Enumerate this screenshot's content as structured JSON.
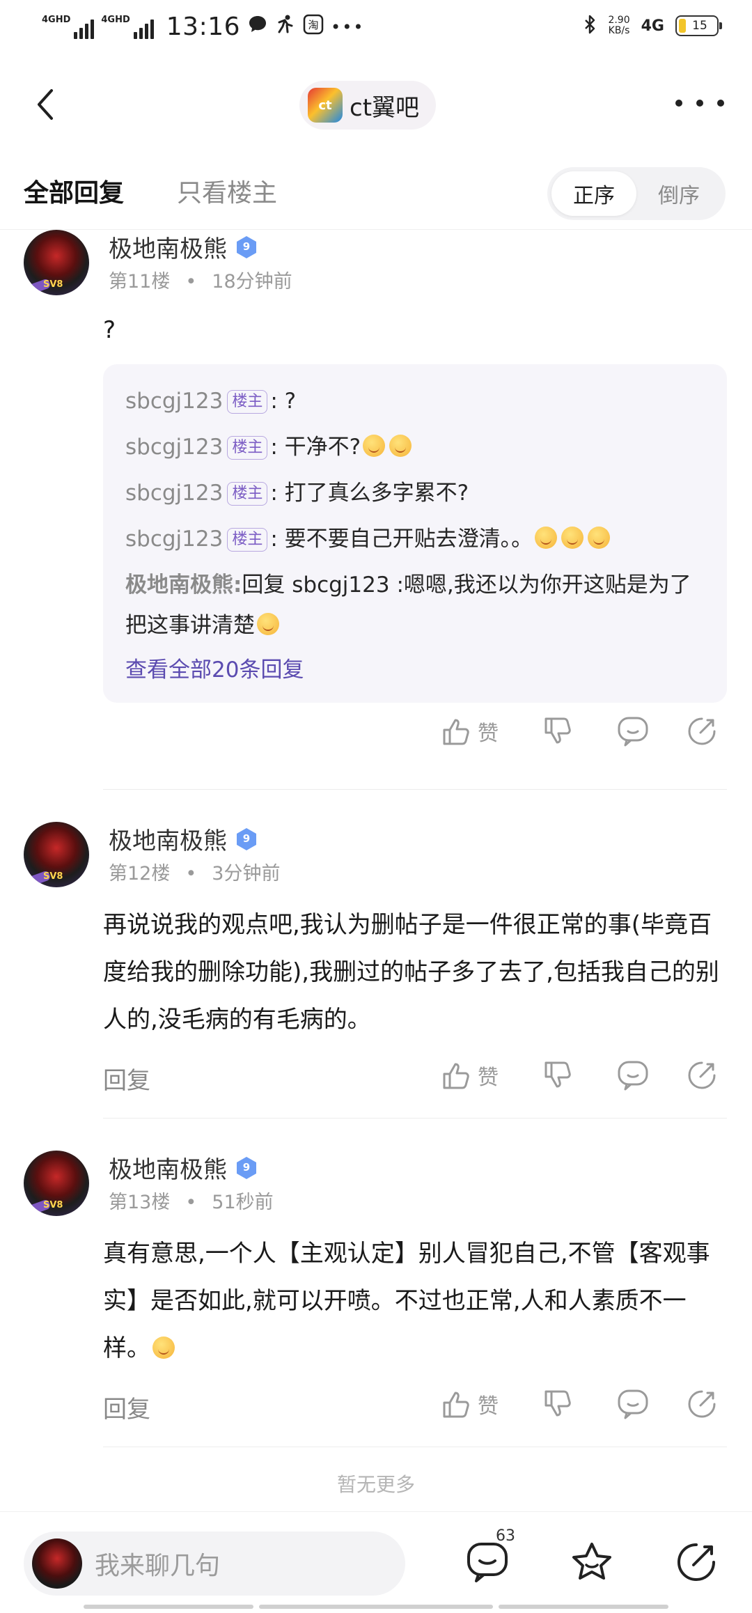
{
  "status_bar": {
    "signal1_label": "4GHD",
    "signal2_label": "4GHD",
    "time": "13:16",
    "net_speed": "2.90",
    "net_unit": "KB/s",
    "network": "4G",
    "battery": "15"
  },
  "header": {
    "forum_name": "ct翼吧"
  },
  "tabs": {
    "all": "全部回复",
    "op_only": "只看楼主",
    "asc": "正序",
    "desc": "倒序"
  },
  "posts": [
    {
      "username": "极地南极熊",
      "level": "9",
      "floor": "第11楼",
      "time": "18分钟前",
      "content": "?",
      "subreplies": [
        {
          "user": "sbcgj123",
          "tag": "楼主",
          "sep": ":",
          "text": "?"
        },
        {
          "user": "sbcgj123",
          "tag": "楼主",
          "sep": ":",
          "text": "干净不?"
        },
        {
          "user": "sbcgj123",
          "tag": "楼主",
          "sep": ":",
          "text": "打了真么多字累不?"
        },
        {
          "user": "sbcgj123",
          "tag": "楼主",
          "sep": ":",
          "text": "要不要自己开贴去澄清。。"
        },
        {
          "user": "极地南极熊",
          "sep": ":",
          "text": "回复 sbcgj123 :嗯嗯,我还以为你开这贴是为了把这事讲清楚"
        }
      ],
      "view_all": "查看全部20条回复",
      "like_label": "赞"
    },
    {
      "username": "极地南极熊",
      "level": "9",
      "floor": "第12楼",
      "time": "3分钟前",
      "content": "再说说我的观点吧,我认为删帖子是一件很正常的事(毕竟百度给我的删除功能),我删过的帖子多了去了,包括我自己的别人的,没毛病的有毛病的。",
      "reply_label": "回复",
      "like_label": "赞"
    },
    {
      "username": "极地南极熊",
      "level": "9",
      "floor": "第13楼",
      "time": "51秒前",
      "content": "真有意思,一个人【主观认定】别人冒犯自己,不管【客观事实】是否如此,就可以开喷。不过也正常,人和人素质不一样。",
      "reply_label": "回复",
      "like_label": "赞"
    }
  ],
  "no_more": "暂无更多",
  "bottom_bar": {
    "input_placeholder": "我来聊几句",
    "comment_count": "63"
  },
  "icons": {
    "back": "chevron-left-icon",
    "more": "more-dots-icon",
    "like": "thumbs-up-icon",
    "dislike": "thumbs-down-icon",
    "comment": "comment-bubble-icon",
    "share": "share-icon",
    "favorite": "star-icon",
    "edit": "edit-icon"
  },
  "colors": {
    "accent_purple": "#5b4bb0",
    "level_badge": "#6a9cf5",
    "text_gray": "#9a9a9a"
  }
}
